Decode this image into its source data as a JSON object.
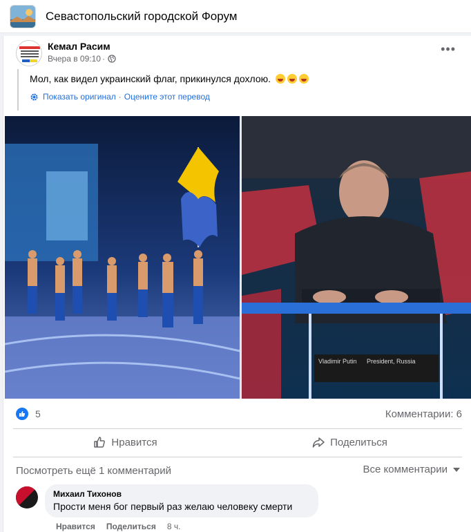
{
  "group": {
    "title": "Севастопольский городской Форум"
  },
  "post": {
    "author": "Кемал Расим",
    "time": "Вчера в 09:10",
    "dot": "·",
    "text": "Мол, как видел украинский флаг, прикинулся дохлою.",
    "show_original": "Показать оригинал",
    "translate_sep": "·",
    "rate_translation": "Оцените этот перевод",
    "photo_caption_name": "Vladimir Putin",
    "photo_caption_role": "President, Russia"
  },
  "stats": {
    "likes": "5",
    "comments": "Комментарии: 6"
  },
  "actions": {
    "like": "Нравится",
    "share": "Поделиться"
  },
  "comments_section": {
    "more": "Посмотреть ещё 1 комментарий",
    "all": "Все комментарии"
  },
  "comment": {
    "author": "Михаил Тихонов",
    "text": "Прости меня бог первый раз желаю человеку смерти",
    "like": "Нравится",
    "reply": "Поделиться",
    "time": "8 ч."
  },
  "icons": [
    "globe-icon",
    "gear-icon",
    "like-icon",
    "share-icon",
    "more-icon",
    "laughing-emoji-icon"
  ],
  "colors": {
    "accent": "#1877f2",
    "link": "#216fdb",
    "muted": "#65676b"
  }
}
